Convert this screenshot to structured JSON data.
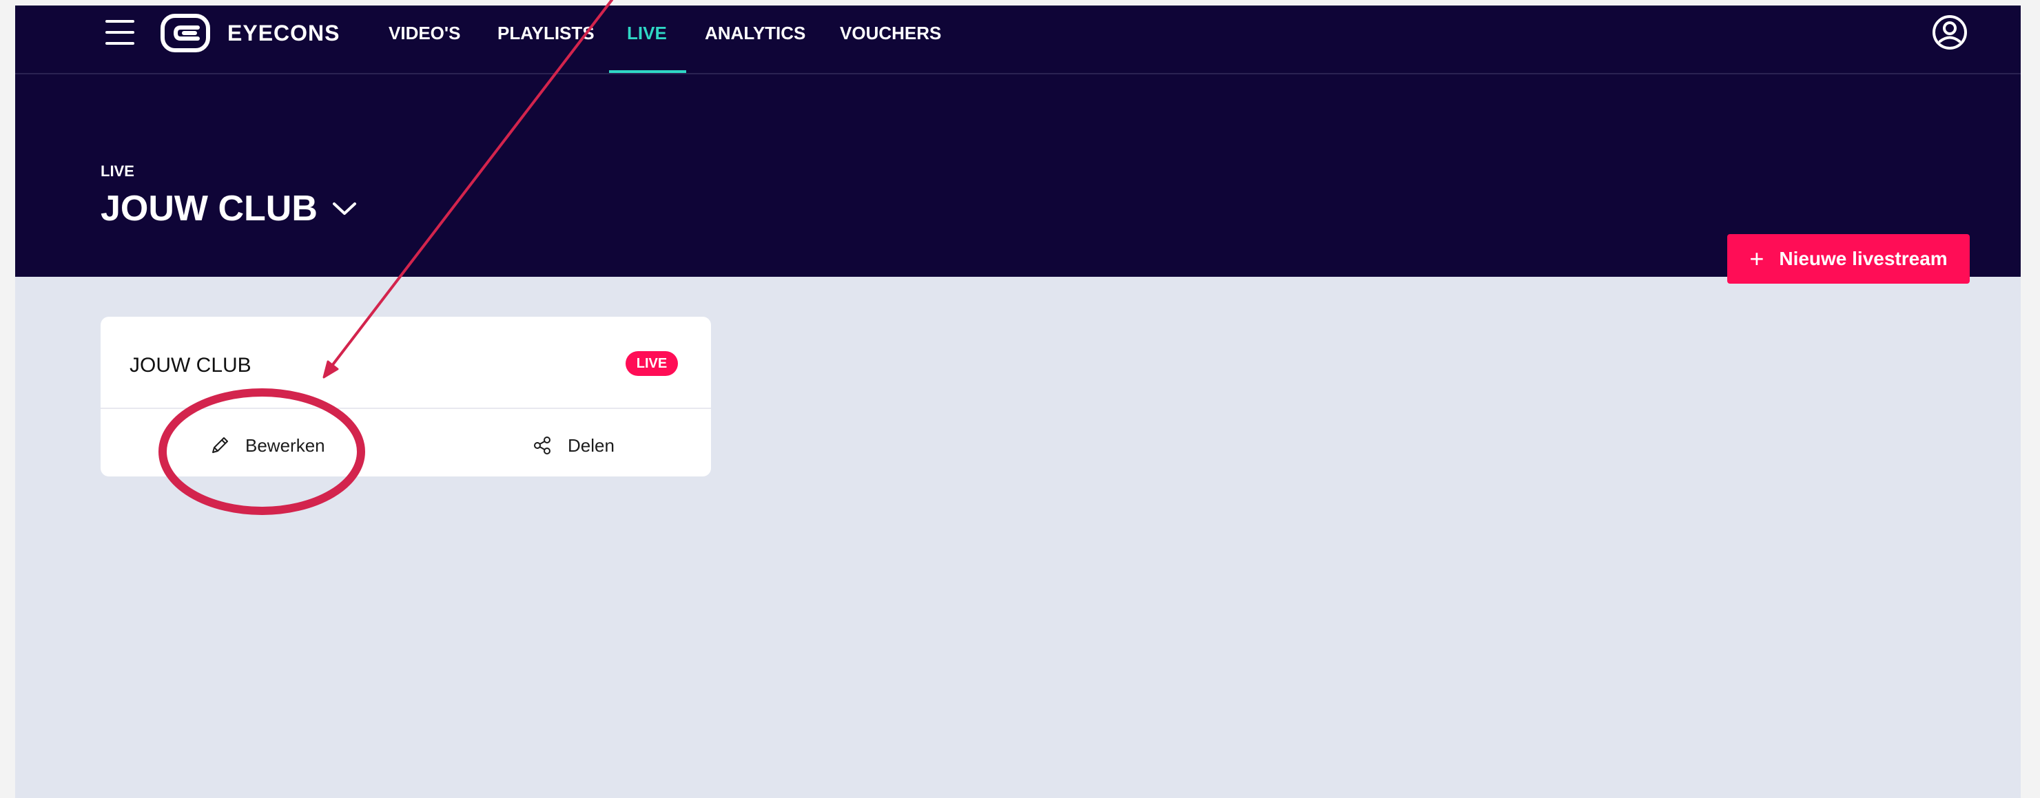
{
  "brand": {
    "logo_text": "EYECONS"
  },
  "nav": {
    "items": [
      {
        "label": "VIDEO'S"
      },
      {
        "label": "PLAYLISTS"
      },
      {
        "label": "LIVE"
      },
      {
        "label": "ANALYTICS"
      },
      {
        "label": "VOUCHERS"
      }
    ],
    "active_item": "LIVE"
  },
  "header": {
    "eyebrow": "LIVE",
    "club_title": "JOUW CLUB"
  },
  "actions": {
    "new_livestream_icon": "+",
    "new_livestream_label": "Nieuwe livestream"
  },
  "livestream_card": {
    "title": "JOUW CLUB",
    "status_badge": "LIVE",
    "edit_label": "Bewerken",
    "share_label": "Delen"
  },
  "icons": {
    "menu": "hamburger-menu-icon",
    "logo": "eyecons-logo",
    "account": "account-icon",
    "dropdown": "chevron-down-icon",
    "edit": "pencil-icon",
    "share": "share-icon"
  },
  "colors": {
    "navy": "#0f0537",
    "accent_teal": "#2fd7c5",
    "accent_pink": "#ff0d56",
    "page_background": "#e1e5ef",
    "annotation_red": "#d3244d"
  }
}
